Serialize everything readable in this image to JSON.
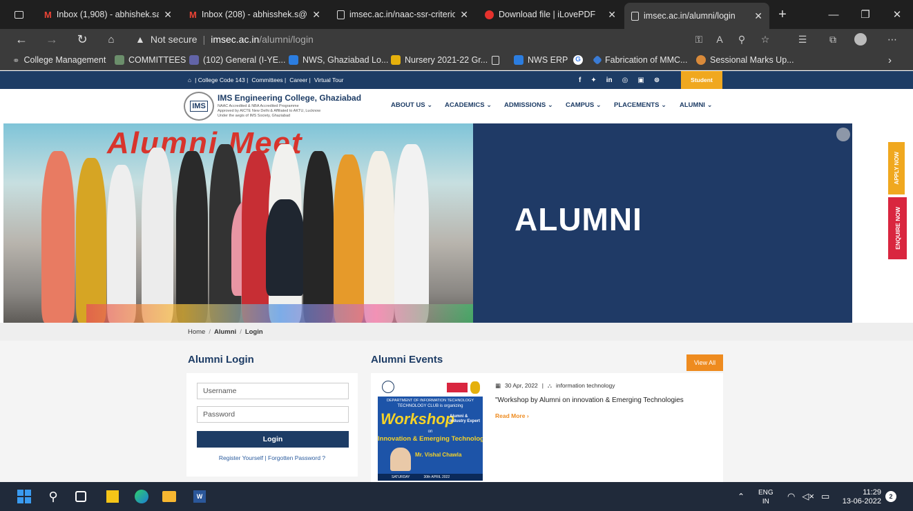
{
  "browser": {
    "tabs": [
      {
        "title": "Inbox (1,908) - abhishek.saxe",
        "icon": "gmail-icon"
      },
      {
        "title": "Inbox (208) - abhisshek.s@gr",
        "icon": "gmail-icon"
      },
      {
        "title": "imsec.ac.in/naac-ssr-criterion",
        "icon": "document-icon"
      },
      {
        "title": "Download file | iLovePDF",
        "icon": "ilovepdf-icon"
      },
      {
        "title": "imsec.ac.in/alumni/login",
        "icon": "document-icon",
        "active": true
      }
    ],
    "security_label": "Not secure",
    "url_host": "imsec.ac.in",
    "url_path": "/alumni/login",
    "favorites": [
      "College Management",
      "COMMITTEES",
      "(102) General (I-YE...",
      "NWS, Ghaziabad Lo...",
      "Nursery 2021-22 Gr...",
      "",
      "NWS ERP",
      "",
      "Fabrication of MMC...",
      "Sessional Marks Up..."
    ]
  },
  "site": {
    "topstrip": {
      "links": [
        "| College Code 143 |",
        "Committees |",
        "Career |",
        "Virtual Tour"
      ],
      "social": [
        "f",
        "t",
        "in",
        "ig",
        "yt",
        "wp"
      ],
      "student_label": "Student"
    },
    "logo": {
      "name": "IMS Engineering College, Ghaziabad",
      "lines": [
        "NAAC Accredited & NBA Accredited Programme",
        "Approved by AICTE New Delhi & Affiliated to AKTU, Lucknow",
        "Under the aegis of IMS Society, Ghaziabad"
      ]
    },
    "nav": [
      "ABOUT US",
      "ACADEMICS",
      "ADMISSIONS",
      "CAMPUS",
      "PLACEMENTS",
      "ALUMNI"
    ],
    "banner": {
      "title": "ALUMNI",
      "photo_text": "Alumni Meet"
    },
    "side_tabs": [
      "APPLY NOW",
      "ENQUIRE NOW"
    ],
    "breadcrumb": [
      "Home",
      "Alumni",
      "Login"
    ],
    "login": {
      "heading": "Alumni Login",
      "username_placeholder": "Username",
      "password_placeholder": "Password",
      "button": "Login",
      "links": "Register Yourself | Forgotten Password ?"
    },
    "events": {
      "heading": "Alumni Events",
      "view_all": "View All",
      "items": [
        {
          "date": "30 Apr, 2022",
          "category": "information technology",
          "title": "\"Workshop by Alumni on innovation & Emerging Technologies",
          "read_more": "Read More"
        }
      ],
      "poster": {
        "dept": "DEPARTMENT OF INFORMATION TECHNOLOGY",
        "club": "TECHNOLOGY CLUB is organizing",
        "title": "Workshop",
        "by": "Alumni & Industry Expert",
        "on": "on",
        "topic": "Innovation & Emerging Technology",
        "speaker": "Mr. Vishal Chawla",
        "day": "SATURDAY",
        "date": "30th APRIL 2022"
      }
    }
  },
  "taskbar": {
    "lang_top": "ENG",
    "lang_bottom": "IN",
    "time": "11:29",
    "date": "13-06-2022",
    "notification_count": "2"
  }
}
